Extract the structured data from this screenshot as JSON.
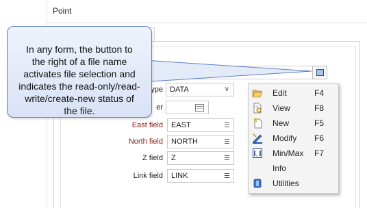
{
  "window": {
    "title": "Point"
  },
  "callout": {
    "text": "In any form, the button to the right of a file name activates file selection and indicates the read-only/read-write/create-new status of the file."
  },
  "form": {
    "type_label_partial": "ype",
    "type_value": "DATA",
    "parameter_label_partial": "er",
    "east_label": "East field",
    "east_value": "EAST",
    "north_label": "North field",
    "north_value": "NORTH",
    "z_label": "Z field",
    "z_value": "Z",
    "link_label": "Link field",
    "link_value": "LINK"
  },
  "context_menu": {
    "items": [
      {
        "label": "Edit",
        "shortcut": "F4",
        "icon": "folder-open-icon"
      },
      {
        "label": "View",
        "shortcut": "F8",
        "icon": "view-file-icon"
      },
      {
        "label": "New",
        "shortcut": "F5",
        "icon": "new-file-icon"
      },
      {
        "label": "Modify",
        "shortcut": "F6",
        "icon": "modify-icon"
      },
      {
        "label": "Min/Max",
        "shortcut": "F7",
        "icon": "minmax-icon"
      },
      {
        "label": "Info",
        "shortcut": "",
        "icon": ""
      },
      {
        "label": "Utilities",
        "shortcut": "",
        "icon": "utilities-icon"
      }
    ]
  },
  "colors": {
    "required_label": "#8b1a1a",
    "callout_border": "#5b7fc4",
    "callout_fill": "#e4ebf8"
  }
}
